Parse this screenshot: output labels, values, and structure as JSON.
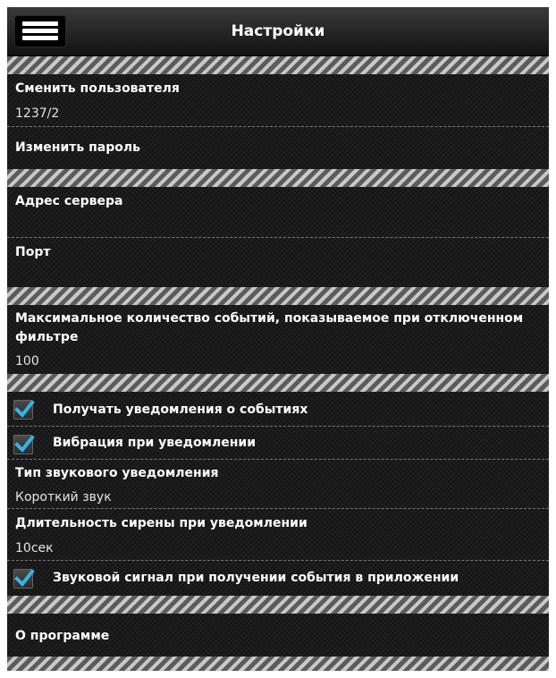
{
  "header": {
    "title": "Настройки",
    "menu_icon": "hamburger-menu-icon"
  },
  "account": {
    "change_user_label": "Сменить пользователя",
    "change_user_value": "1237/2",
    "change_password_label": "Изменить пароль"
  },
  "server": {
    "address_label": "Адрес сервера",
    "address_value": "",
    "port_label": "Порт",
    "port_value": ""
  },
  "events": {
    "max_events_label_line1": "Максимальное количество событий, показываемое при отключенном",
    "max_events_label_line2": "фильтре",
    "max_events_value": "100"
  },
  "notifications": {
    "receive_label": "Получать уведомления о событиях",
    "receive_checked": true,
    "vibration_label": "Вибрация при уведомлении",
    "vibration_checked": true,
    "sound_type_label": "Тип звукового уведомления",
    "sound_type_value": "Короткий звук",
    "siren_duration_label": "Длительность сирены при уведомлении",
    "siren_duration_value": "10сек",
    "in_app_sound_label": "Звуковой сигнал при получении события в приложении",
    "in_app_sound_checked": true,
    "check_color": "#33b5e5"
  },
  "about": {
    "label": "О программе"
  }
}
